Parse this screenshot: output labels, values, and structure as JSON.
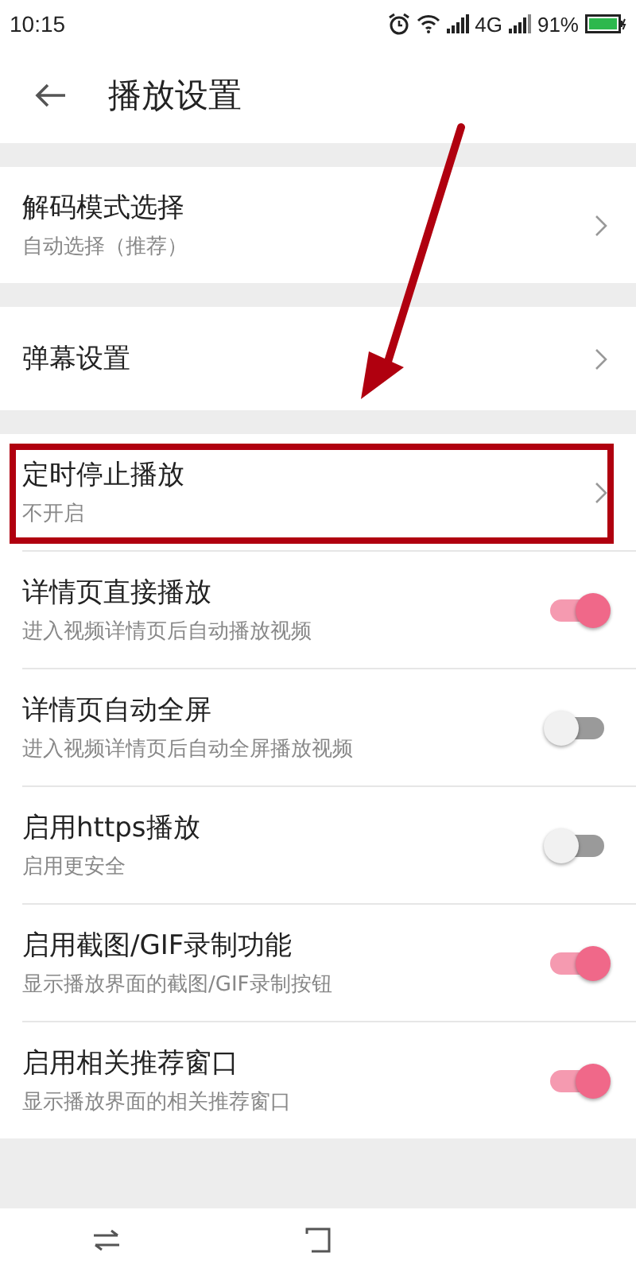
{
  "status_bar": {
    "time": "10:15",
    "network": "4G",
    "battery": "91%"
  },
  "header": {
    "title": "播放设置"
  },
  "sections": [
    {
      "items": [
        {
          "kind": "link",
          "title": "解码模式选择",
          "subtitle": "自动选择（推荐）",
          "highlighted": false
        }
      ]
    },
    {
      "items": [
        {
          "kind": "link",
          "title": "弹幕设置",
          "highlighted": false
        }
      ]
    },
    {
      "items": [
        {
          "kind": "link",
          "title": "定时停止播放",
          "subtitle": "不开启",
          "highlighted": true
        },
        {
          "kind": "switch",
          "title": "详情页直接播放",
          "subtitle": "进入视频详情页后自动播放视频",
          "on": true,
          "highlighted": false
        },
        {
          "kind": "switch",
          "title": "详情页自动全屏",
          "subtitle": "进入视频详情页后自动全屏播放视频",
          "on": false,
          "highlighted": false
        },
        {
          "kind": "switch",
          "title": "启用https播放",
          "subtitle": "启用更安全",
          "on": false,
          "highlighted": false
        },
        {
          "kind": "switch",
          "title": "启用截图/GIF录制功能",
          "subtitle": "显示播放界面的截图/GIF录制按钮",
          "on": true,
          "highlighted": false
        },
        {
          "kind": "switch",
          "title": "启用相关推荐窗口",
          "subtitle": "显示播放界面的相关推荐窗口",
          "on": true,
          "highlighted": false
        }
      ]
    }
  ]
}
